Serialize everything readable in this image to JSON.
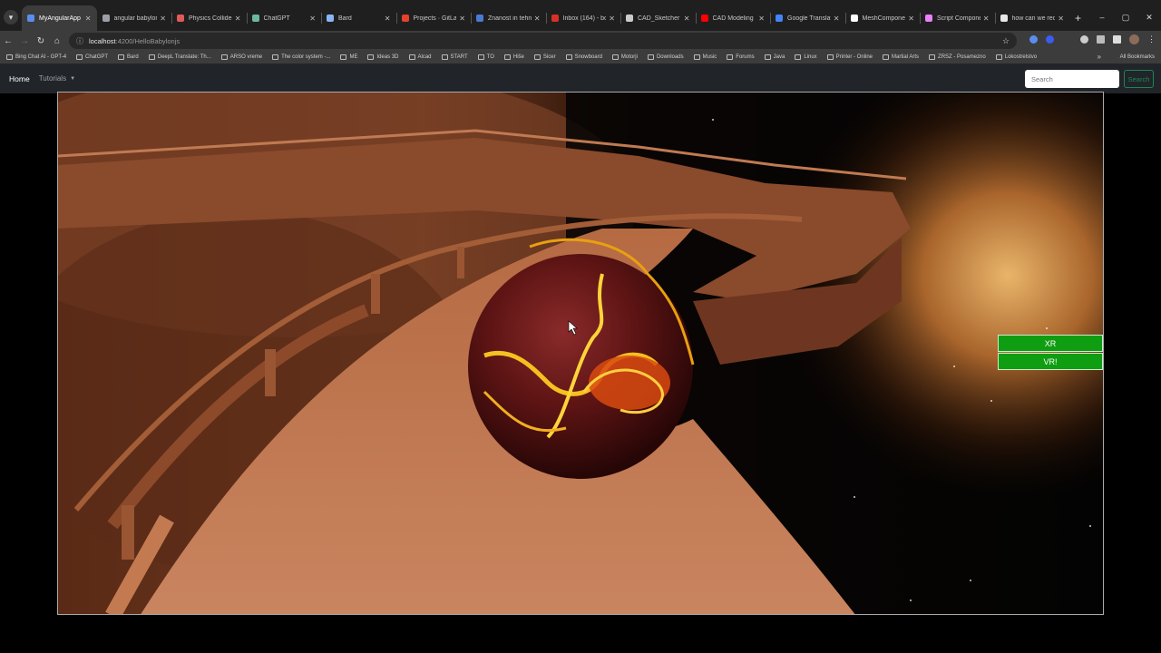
{
  "browser": {
    "tabs": [
      {
        "title": "MyAngularApp",
        "active": true,
        "color": "#5b8def"
      },
      {
        "title": "angular babylonjs",
        "color": "#9aa0a6"
      },
      {
        "title": "Physics Collider C",
        "color": "#e05a5a"
      },
      {
        "title": "ChatGPT",
        "color": "#6bb7a2"
      },
      {
        "title": "Bard",
        "color": "#8ab4f8"
      },
      {
        "title": "Projects · GitLab",
        "color": "#e2432a"
      },
      {
        "title": "Znanost in tehn",
        "color": "#4a7bd4"
      },
      {
        "title": "Inbox (164) - boj",
        "color": "#d93025"
      },
      {
        "title": "CAD_Sketcher - G",
        "color": "#cccccc"
      },
      {
        "title": "CAD Modeling Ii",
        "color": "#ff0000"
      },
      {
        "title": "Google Translate",
        "color": "#4285f4"
      },
      {
        "title": "MeshComponen",
        "color": "#ffffff"
      },
      {
        "title": "Script Compone",
        "color": "#ea80fc"
      },
      {
        "title": "how can we reco",
        "color": "#e8e8e8"
      }
    ],
    "new_tab_icon": "+",
    "window_controls": [
      "–",
      "▢",
      "✕"
    ],
    "address": {
      "host": "localhost",
      "path": ":4200/HelloBabylonjs"
    },
    "bookmarks": [
      "Bing Chat AI - GPT-4",
      "ChatGPT",
      "Bard",
      "DeepL Translate: Th...",
      "ARSO vreme",
      "The color system -...",
      "ME",
      "Ideas 3D",
      "Alcad",
      "START",
      "TO",
      "Hiše",
      "Sicer",
      "Snowboard",
      "Motorji",
      "Downloads",
      "Music",
      "Forums",
      "Java",
      "Linux",
      "Printer - Online",
      "Martial Arts",
      "ZRSZ - Posamezno",
      "Lokostrelstvo"
    ],
    "bookmarks_more": "»",
    "all_bookmarks": "All Bookmarks"
  },
  "app": {
    "brand": "Home",
    "nav_tutorials": "Tutorials",
    "search_placeholder": "Search",
    "search_button": "Search",
    "xr_button": "XR",
    "vr_button": "VR!"
  },
  "colors": {
    "accent_green": "#0f9d11",
    "navbar": "#212529"
  }
}
